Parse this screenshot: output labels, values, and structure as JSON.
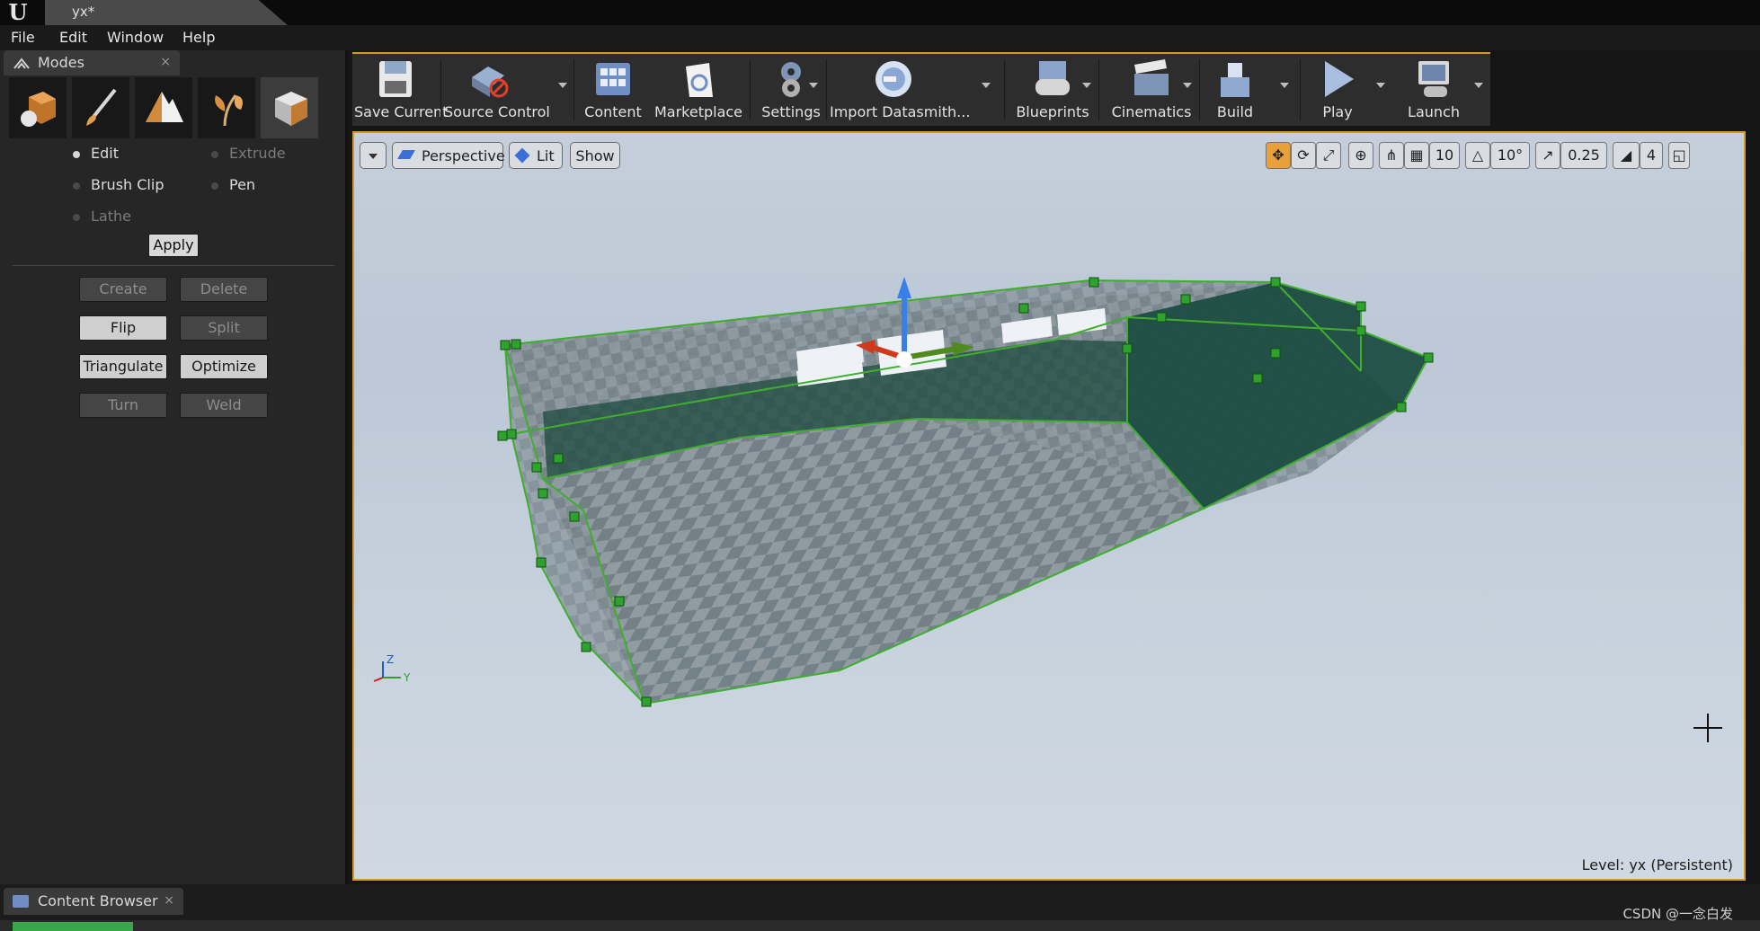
{
  "window": {
    "tab_title": "yx*"
  },
  "menu": [
    "File",
    "Edit",
    "Window",
    "Help"
  ],
  "modes_panel": {
    "tab_label": "Modes",
    "close_glyph": "×",
    "mode_icons": [
      "place-mode-icon",
      "paint-mode-icon",
      "landscape-mode-icon",
      "foliage-mode-icon",
      "geometry-mode-icon"
    ],
    "radio_options": [
      {
        "label": "Edit",
        "selected": true,
        "enabled": true
      },
      {
        "label": "Extrude",
        "selected": false,
        "enabled": false
      },
      {
        "label": "Brush Clip",
        "selected": false,
        "enabled": true
      },
      {
        "label": "Pen",
        "selected": false,
        "enabled": true
      },
      {
        "label": "Lathe",
        "selected": false,
        "enabled": false
      }
    ],
    "apply_label": "Apply",
    "buttons": [
      {
        "label": "Create",
        "enabled": false
      },
      {
        "label": "Delete",
        "enabled": false
      },
      {
        "label": "Flip",
        "enabled": true
      },
      {
        "label": "Split",
        "enabled": false
      },
      {
        "label": "Triangulate",
        "enabled": true
      },
      {
        "label": "Optimize",
        "enabled": true
      },
      {
        "label": "Turn",
        "enabled": false
      },
      {
        "label": "Weld",
        "enabled": false
      }
    ]
  },
  "toolbar": {
    "items": [
      {
        "label": "Save Current",
        "icon": "save-icon",
        "dropdown": false
      },
      {
        "label": "Source Control",
        "icon": "source-control-icon",
        "dropdown": true
      },
      {
        "label": "Content",
        "icon": "content-icon",
        "dropdown": false
      },
      {
        "label": "Marketplace",
        "icon": "marketplace-icon",
        "dropdown": false
      },
      {
        "label": "Settings",
        "icon": "settings-icon",
        "dropdown": true
      },
      {
        "label": "Import Datasmith...",
        "icon": "datasmith-icon",
        "dropdown": true
      },
      {
        "label": "Blueprints",
        "icon": "blueprints-icon",
        "dropdown": true
      },
      {
        "label": "Cinematics",
        "icon": "cinematics-icon",
        "dropdown": true
      },
      {
        "label": "Build",
        "icon": "build-icon",
        "dropdown": true
      },
      {
        "label": "Play",
        "icon": "play-icon",
        "dropdown": true
      },
      {
        "label": "Launch",
        "icon": "launch-icon",
        "dropdown": true
      }
    ]
  },
  "viewport": {
    "view_mode": "Perspective",
    "lighting": "Lit",
    "show_label": "Show",
    "grid_snap": "10",
    "rotation_snap": "10°",
    "scale_snap": "0.25",
    "camera_speed": "4",
    "level_label": "Level:  yx (Persistent)",
    "axis_labels": {
      "z": "Z",
      "y": "Y"
    }
  },
  "content_browser": {
    "tab_label": "Content Browser",
    "close_glyph": "×"
  },
  "watermark": "CSDN @一念白发",
  "colors": {
    "accent": "#d49a26",
    "brush_green": "#2fa12f",
    "add_new_green": "#3aa64b"
  }
}
